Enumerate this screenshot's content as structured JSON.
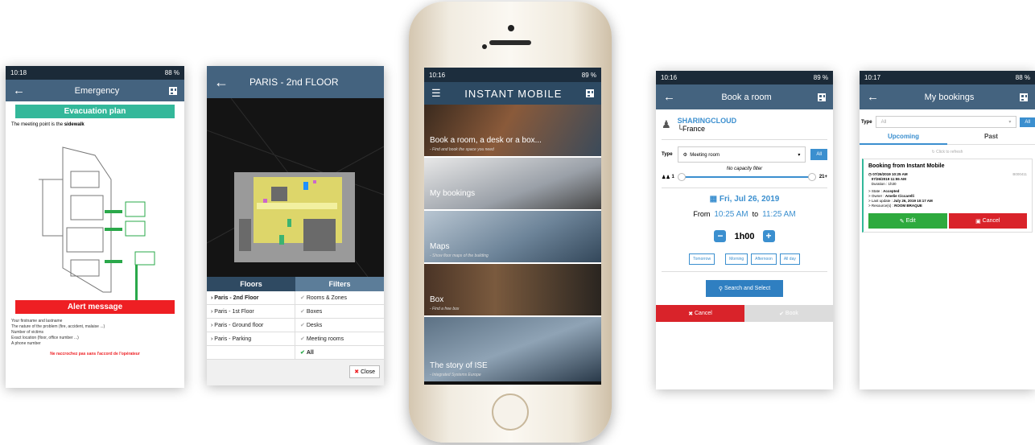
{
  "emergency": {
    "time": "10:18",
    "battery": "88 %",
    "title": "Emergency",
    "evac": "Evacuation plan",
    "meeting_text_a": "The meeting point is the",
    "meeting_text_b": "sidewalk",
    "alert": "Alert message",
    "items": [
      "Your firstname and lastname",
      "The nature of the problem (fire, accident, malaise ...)",
      "Number of victims",
      "Exact location (floor, office number ...)",
      "A phone number"
    ],
    "warning": "Ne raccrochez pas sans l'accord de l'opérateur"
  },
  "floor": {
    "title": "PARIS - 2nd FLOOR",
    "tab_floors": "Floors",
    "tab_filters": "Filters",
    "floors": [
      "Paris - 2nd Floor",
      "Paris - 1st Floor",
      "Paris - Ground floor",
      "Paris - Parking"
    ],
    "filters": [
      "Rooms & Zones",
      "Boxes",
      "Desks",
      "Meeting rooms",
      "All"
    ],
    "close": "Close"
  },
  "phone": {
    "time": "10:16",
    "battery": "89 %",
    "brand": "INSTANT MOBILE",
    "tiles": [
      {
        "title": "Book a room, a desk or a box...",
        "sub": "- Find and book the space you need"
      },
      {
        "title": "My bookings",
        "sub": ""
      },
      {
        "title": "Maps",
        "sub": "- Show floor maps of the building"
      },
      {
        "title": "Box",
        "sub": "- Find a free box"
      },
      {
        "title": "The story of ISE",
        "sub": "- Integrated Systems Europe"
      }
    ]
  },
  "book": {
    "time": "10:16",
    "battery": "89 %",
    "title": "Book a room",
    "org": "SHARINGCLOUD",
    "country": "France",
    "type_label": "Type",
    "type_value": "Meeting room",
    "all": "All",
    "capacity": "No capacity filter",
    "cap_min": "1",
    "cap_max": "21+",
    "date": "Fri, Jul 26, 2019",
    "from_label": "From",
    "from_time": "10:25 AM",
    "to_label": "to",
    "to_time": "11:25 AM",
    "duration": "1h00",
    "quick": [
      "Tomorrow",
      "Morning",
      "Afternoon",
      "All day"
    ],
    "search": "Search and Select",
    "cancel": "Cancel",
    "book": "Book"
  },
  "bookings": {
    "time": "10:17",
    "battery": "88 %",
    "title": "My bookings",
    "type_label": "Type",
    "type_value": "All",
    "all": "All",
    "tab_upcoming": "Upcoming",
    "tab_past": "Past",
    "refresh": "Click to refresh",
    "card_title": "Booking from Instant Mobile",
    "d1": "07/26/2019 10:25 AM",
    "d2": "07/26/2019 11:55 AM",
    "duration": "Duration : 1h30",
    "code": "B000411",
    "state_label": "> State :",
    "state": "Accepted",
    "owner_label": "> Owner :",
    "owner": "Amelie Ciccarelli",
    "update_label": "> Last update :",
    "update": "July 26, 2019 10:17 AM",
    "resource_label": "> Resource(s) :",
    "resource": "ROOM BRAQUE",
    "edit": "Edit",
    "cancel": "Cancel"
  },
  "colors": {
    "header": "#44637f",
    "green": "#33b89a",
    "red": "#ee1f23",
    "blue": "#3b8fcf"
  }
}
